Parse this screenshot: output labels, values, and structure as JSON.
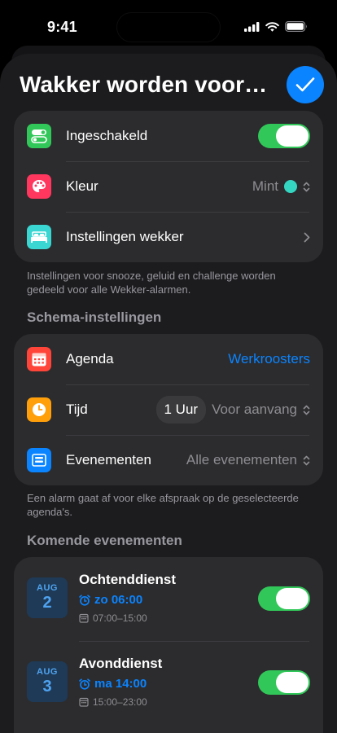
{
  "status_bar": {
    "time": "9:41"
  },
  "sheet": {
    "title": "Wakker worden voor…"
  },
  "general_card": {
    "enabled": {
      "label": "Ingeschakeld",
      "on": true,
      "icon": "toggle-icon",
      "color": "#32c759"
    },
    "color": {
      "label": "Kleur",
      "value": "Mint",
      "swatch": "#34d6c2",
      "icon": "palette-icon",
      "color": "#ff375f"
    },
    "alarm_settings": {
      "label": "Instellingen wekker",
      "icon": "bed-icon",
      "color": "#3ad6d2"
    }
  },
  "general_footnote": "Instellingen voor snooze, geluid en challenge worden gedeeld voor alle Wekker-alarmen.",
  "schedule": {
    "header": "Schema-instellingen",
    "calendar": {
      "label": "Agenda",
      "value": "Werkroosters",
      "icon": "calendar-icon",
      "color": "#ff453a"
    },
    "time": {
      "label": "Tijd",
      "amount": "1 Uur",
      "value": "Voor aanvang",
      "icon": "clock-icon",
      "color": "#ff9f0a"
    },
    "events": {
      "label": "Evenementen",
      "value": "Alle evenementen",
      "icon": "events-list-icon",
      "color": "#0a84ff"
    },
    "footnote": "Een alarm gaat af voor elke afspraak op de geselecteerde agenda's."
  },
  "upcoming": {
    "header": "Komende evenementen",
    "items": [
      {
        "month": "AUG",
        "day": "2",
        "title": "Ochtenddienst",
        "alarm": "zo 06:00",
        "hours": "07:00–15:00",
        "on": true
      },
      {
        "month": "AUG",
        "day": "3",
        "title": "Avonddienst",
        "alarm": "ma 14:00",
        "hours": "15:00–23:00",
        "on": true
      }
    ]
  },
  "colors": {
    "accent": "#0a84ff",
    "toggle_on": "#32c759"
  }
}
